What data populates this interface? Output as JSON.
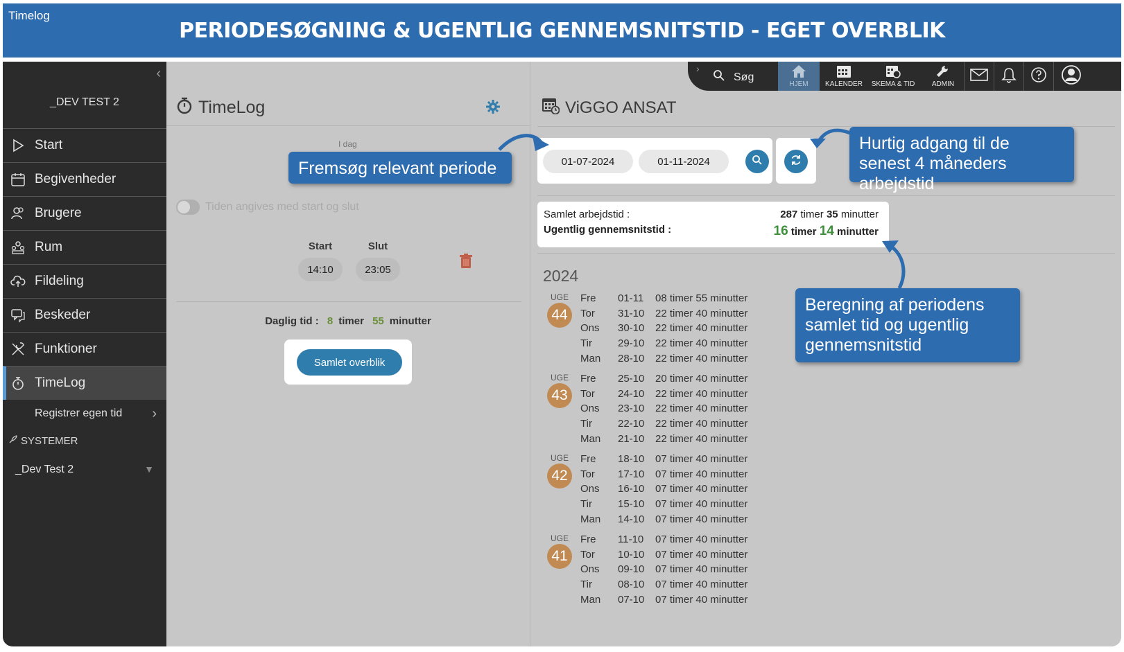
{
  "window": {
    "app_name": "Timelog"
  },
  "banner": {
    "title": "PERIODESØGNING & UGENTLIG GENNEMSNITSTID - EGET OVERBLIK"
  },
  "sidebar": {
    "org": "_DEV TEST 2",
    "items": [
      {
        "label": "Start",
        "icon": "play-icon"
      },
      {
        "label": "Begivenheder",
        "icon": "calendar-icon"
      },
      {
        "label": "Brugere",
        "icon": "users-icon"
      },
      {
        "label": "Rum",
        "icon": "room-icon"
      },
      {
        "label": "Fildeling",
        "icon": "cloud-icon"
      },
      {
        "label": "Beskeder",
        "icon": "chat-icon"
      },
      {
        "label": "Funktioner",
        "icon": "tools-icon"
      },
      {
        "label": "TimeLog",
        "icon": "stopwatch-icon"
      }
    ],
    "sub_item": "Registrer egen tid",
    "systems_label": "SYSTEMER",
    "system_value": "_Dev Test 2"
  },
  "timelog": {
    "title": "TimeLog",
    "today_label": "I dag",
    "toggle_label": "Tiden angives med start og slut",
    "start_label": "Start",
    "end_label": "Slut",
    "start_value": "14:10",
    "end_value": "23:05",
    "daily_label": "Daglig tid :",
    "daily_hours": "8",
    "daily_hours_unit": "timer",
    "daily_minutes": "55",
    "daily_minutes_unit": "minutter",
    "overview_button": "Samlet overblik"
  },
  "viggo": {
    "title": "ViGGO ANSAT",
    "date_from": "01-07-2024",
    "date_to": "01-11-2024",
    "total_label": "Samlet arbejdstid :",
    "total_hours": "287",
    "total_minutes": "35",
    "avg_label": "Ugentlig gennemsnitstid :",
    "avg_hours": "16",
    "avg_minutes": "14",
    "unit_hours": "timer",
    "unit_minutes": "minutter",
    "year": "2024",
    "week_label": "UGE",
    "weeks": [
      {
        "number": "44",
        "days": [
          {
            "name": "Fre",
            "date": "01-11",
            "time": "08 timer 55 minutter"
          },
          {
            "name": "Tor",
            "date": "31-10",
            "time": "22 timer 40 minutter"
          },
          {
            "name": "Ons",
            "date": "30-10",
            "time": "22 timer 40 minutter"
          },
          {
            "name": "Tir",
            "date": "29-10",
            "time": "22 timer 40 minutter"
          },
          {
            "name": "Man",
            "date": "28-10",
            "time": "22 timer 40 minutter"
          }
        ]
      },
      {
        "number": "43",
        "days": [
          {
            "name": "Fre",
            "date": "25-10",
            "time": "20 timer 40 minutter"
          },
          {
            "name": "Tor",
            "date": "24-10",
            "time": "22 timer 40 minutter"
          },
          {
            "name": "Ons",
            "date": "23-10",
            "time": "22 timer 40 minutter"
          },
          {
            "name": "Tir",
            "date": "22-10",
            "time": "22 timer 40 minutter"
          },
          {
            "name": "Man",
            "date": "21-10",
            "time": "22 timer 40 minutter"
          }
        ]
      },
      {
        "number": "42",
        "days": [
          {
            "name": "Fre",
            "date": "18-10",
            "time": "07 timer 40 minutter"
          },
          {
            "name": "Tor",
            "date": "17-10",
            "time": "07 timer 40 minutter"
          },
          {
            "name": "Ons",
            "date": "16-10",
            "time": "07 timer 40 minutter"
          },
          {
            "name": "Tir",
            "date": "15-10",
            "time": "07 timer 40 minutter"
          },
          {
            "name": "Man",
            "date": "14-10",
            "time": "07 timer 40 minutter"
          }
        ]
      },
      {
        "number": "41",
        "days": [
          {
            "name": "Fre",
            "date": "11-10",
            "time": "07 timer 40 minutter"
          },
          {
            "name": "Tor",
            "date": "10-10",
            "time": "07 timer 40 minutter"
          },
          {
            "name": "Ons",
            "date": "09-10",
            "time": "07 timer 40 minutter"
          },
          {
            "name": "Tir",
            "date": "08-10",
            "time": "07 timer 40 minutter"
          },
          {
            "name": "Man",
            "date": "07-10",
            "time": "07 timer 40 minutter"
          }
        ]
      }
    ]
  },
  "topbar": {
    "search_label": "Søg",
    "hjem": "HJEM",
    "kalender": "KALENDER",
    "skema": "SKEMA & TID",
    "admin": "ADMIN"
  },
  "callouts": {
    "search_period": "Fremsøg relevant periode",
    "quick_access": "Hurtig adgang til de senest 4 måneders arbejdstid",
    "calculation": "Beregning af periodens samlet tid og ugentlig gennemsnitstid"
  },
  "colors": {
    "banner": "#2e6cb0",
    "accent": "#2e7dad",
    "week_badge": "#c08a52",
    "green": "#3d8f3a"
  }
}
